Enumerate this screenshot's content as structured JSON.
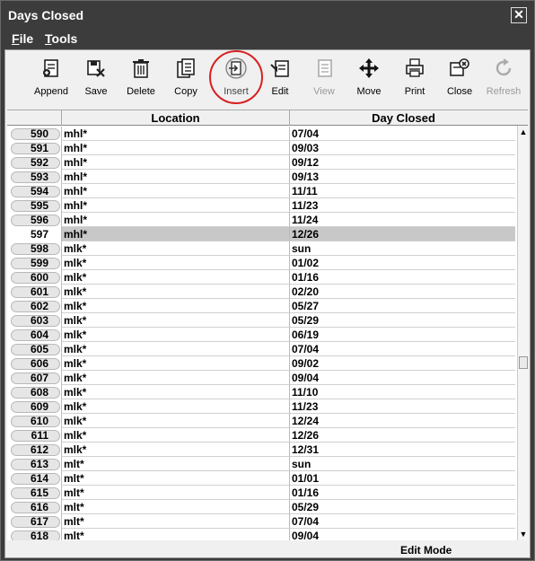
{
  "window": {
    "title": "Days Closed"
  },
  "menu": [
    {
      "prefix": "F",
      "rest": "ile"
    },
    {
      "prefix": "T",
      "rest": "ools"
    }
  ],
  "toolbar": {
    "append": "Append",
    "save": "Save",
    "delete": "Delete",
    "copy": "Copy",
    "insert": "Insert",
    "edit": "Edit",
    "view": "View",
    "move": "Move",
    "print": "Print",
    "close": "Close",
    "refresh": "Refresh"
  },
  "grid": {
    "headers": {
      "location": "Location",
      "day_closed": "Day Closed"
    },
    "rows": [
      {
        "num": "590",
        "location": "mhl*",
        "day": "07/04"
      },
      {
        "num": "591",
        "location": "mhl*",
        "day": "09/03"
      },
      {
        "num": "592",
        "location": "mhl*",
        "day": "09/12"
      },
      {
        "num": "593",
        "location": "mhl*",
        "day": "09/13"
      },
      {
        "num": "594",
        "location": "mhl*",
        "day": "11/11"
      },
      {
        "num": "595",
        "location": "mhl*",
        "day": "11/23"
      },
      {
        "num": "596",
        "location": "mhl*",
        "day": "11/24"
      },
      {
        "num": "597",
        "location": "mhl*",
        "day": "12/26"
      },
      {
        "num": "598",
        "location": "mlk*",
        "day": "sun"
      },
      {
        "num": "599",
        "location": "mlk*",
        "day": "01/02"
      },
      {
        "num": "600",
        "location": "mlk*",
        "day": "01/16"
      },
      {
        "num": "601",
        "location": "mlk*",
        "day": "02/20"
      },
      {
        "num": "602",
        "location": "mlk*",
        "day": "05/27"
      },
      {
        "num": "603",
        "location": "mlk*",
        "day": "05/29"
      },
      {
        "num": "604",
        "location": "mlk*",
        "day": "06/19"
      },
      {
        "num": "605",
        "location": "mlk*",
        "day": "07/04"
      },
      {
        "num": "606",
        "location": "mlk*",
        "day": "09/02"
      },
      {
        "num": "607",
        "location": "mlk*",
        "day": "09/04"
      },
      {
        "num": "608",
        "location": "mlk*",
        "day": "11/10"
      },
      {
        "num": "609",
        "location": "mlk*",
        "day": "11/23"
      },
      {
        "num": "610",
        "location": "mlk*",
        "day": "12/24"
      },
      {
        "num": "611",
        "location": "mlk*",
        "day": "12/26"
      },
      {
        "num": "612",
        "location": "mlk*",
        "day": "12/31"
      },
      {
        "num": "613",
        "location": "mlt*",
        "day": "sun"
      },
      {
        "num": "614",
        "location": "mlt*",
        "day": "01/01"
      },
      {
        "num": "615",
        "location": "mlt*",
        "day": "01/16"
      },
      {
        "num": "616",
        "location": "mlt*",
        "day": "05/29"
      },
      {
        "num": "617",
        "location": "mlt*",
        "day": "07/04"
      },
      {
        "num": "618",
        "location": "mlt*",
        "day": "09/04"
      }
    ],
    "selected_row": "597"
  },
  "status": {
    "mode": "Edit Mode"
  },
  "colors": {
    "highlight_ring": "#d92020",
    "selected_row": "#c8c8c8",
    "chrome": "#3c3c3c"
  }
}
